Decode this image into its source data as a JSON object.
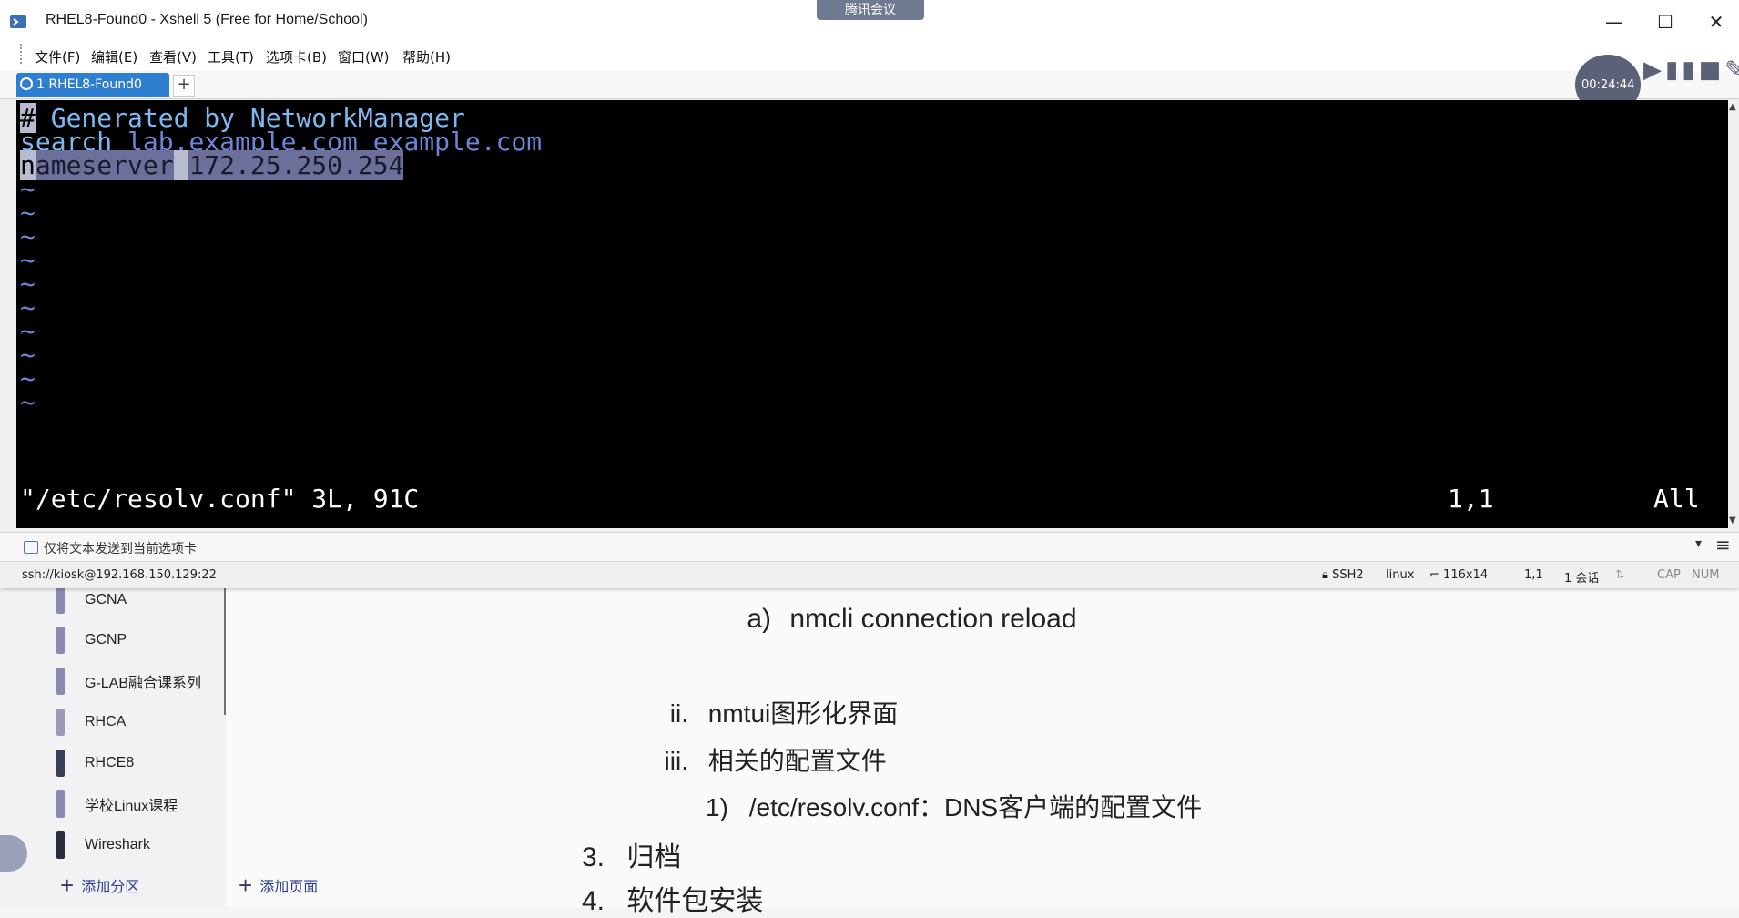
{
  "window": {
    "title": "RHEL8-Found0 - Xshell 5 (Free for Home/School)",
    "meeting_badge": "腾讯会议",
    "minimize": "—",
    "maximize": "☐",
    "close": "✕"
  },
  "menu": [
    "文件(F)",
    "编辑(E)",
    "查看(V)",
    "工具(T)",
    "选项卡(B)",
    "窗口(W)",
    "帮助(H)"
  ],
  "tabs": [
    {
      "label": "1 RHEL8-Found0",
      "active": true
    }
  ],
  "tab_add": "+",
  "recording": {
    "time": "00:24:44",
    "controls": "▶▮▮■✎"
  },
  "terminal": {
    "line1_hash": "#",
    "line1_rest": " Generated by NetworkManager",
    "line2_head": "s",
    "line2_key": "earch",
    "line2_rest": " lab.example.com example.com",
    "line3_n": "n",
    "line3_key": "ameserver",
    "line3_gap": " ",
    "line3_val": "172.25.250.254",
    "tilde": "~",
    "status_file": "\"/etc/resolv.conf\" 3L, 91C",
    "status_pos": "1,1",
    "status_all": "All"
  },
  "compose": {
    "placeholder": "仅将文本发送到当前选项卡",
    "dropdown": "▾",
    "menu": "≡"
  },
  "statusbar": {
    "connection": "ssh://kiosk@192.168.150.129:22",
    "protocol": "SSH2",
    "term": "linux",
    "size": "116x14",
    "cursor": "1,1",
    "sessions": "1 会话",
    "cap": "CAP",
    "num": "NUM"
  },
  "background": {
    "sections": [
      {
        "label": "GCNA",
        "color": "#8a8ab0"
      },
      {
        "label": "GCNP",
        "color": "#8a8ab0"
      },
      {
        "label": "G-LAB融合课系列",
        "color": "#8a8ab0"
      },
      {
        "label": "RHCA",
        "color": "#9a9ab6"
      },
      {
        "label": "RHCE8",
        "color": "#3a3f55"
      },
      {
        "label": "学校Linux课程",
        "color": "#8a8ab0"
      },
      {
        "label": "Wireshark",
        "color": "#2a2e3c"
      }
    ],
    "add_section": "添加分区",
    "add_page": "添加页面",
    "notes": {
      "a_num": "a)",
      "a_text": "nmcli connection reload",
      "ii_num": "ii.",
      "ii_text": "nmtui图形化界面",
      "iii_num": "iii.",
      "iii_text": "相关的配置文件",
      "one_num": "1)",
      "one_text": "/etc/resolv.conf：DNS客户端的配置文件",
      "three_num": "3.",
      "three_text": "归档",
      "four_num": "4.",
      "four_text": "软件包安装"
    }
  }
}
